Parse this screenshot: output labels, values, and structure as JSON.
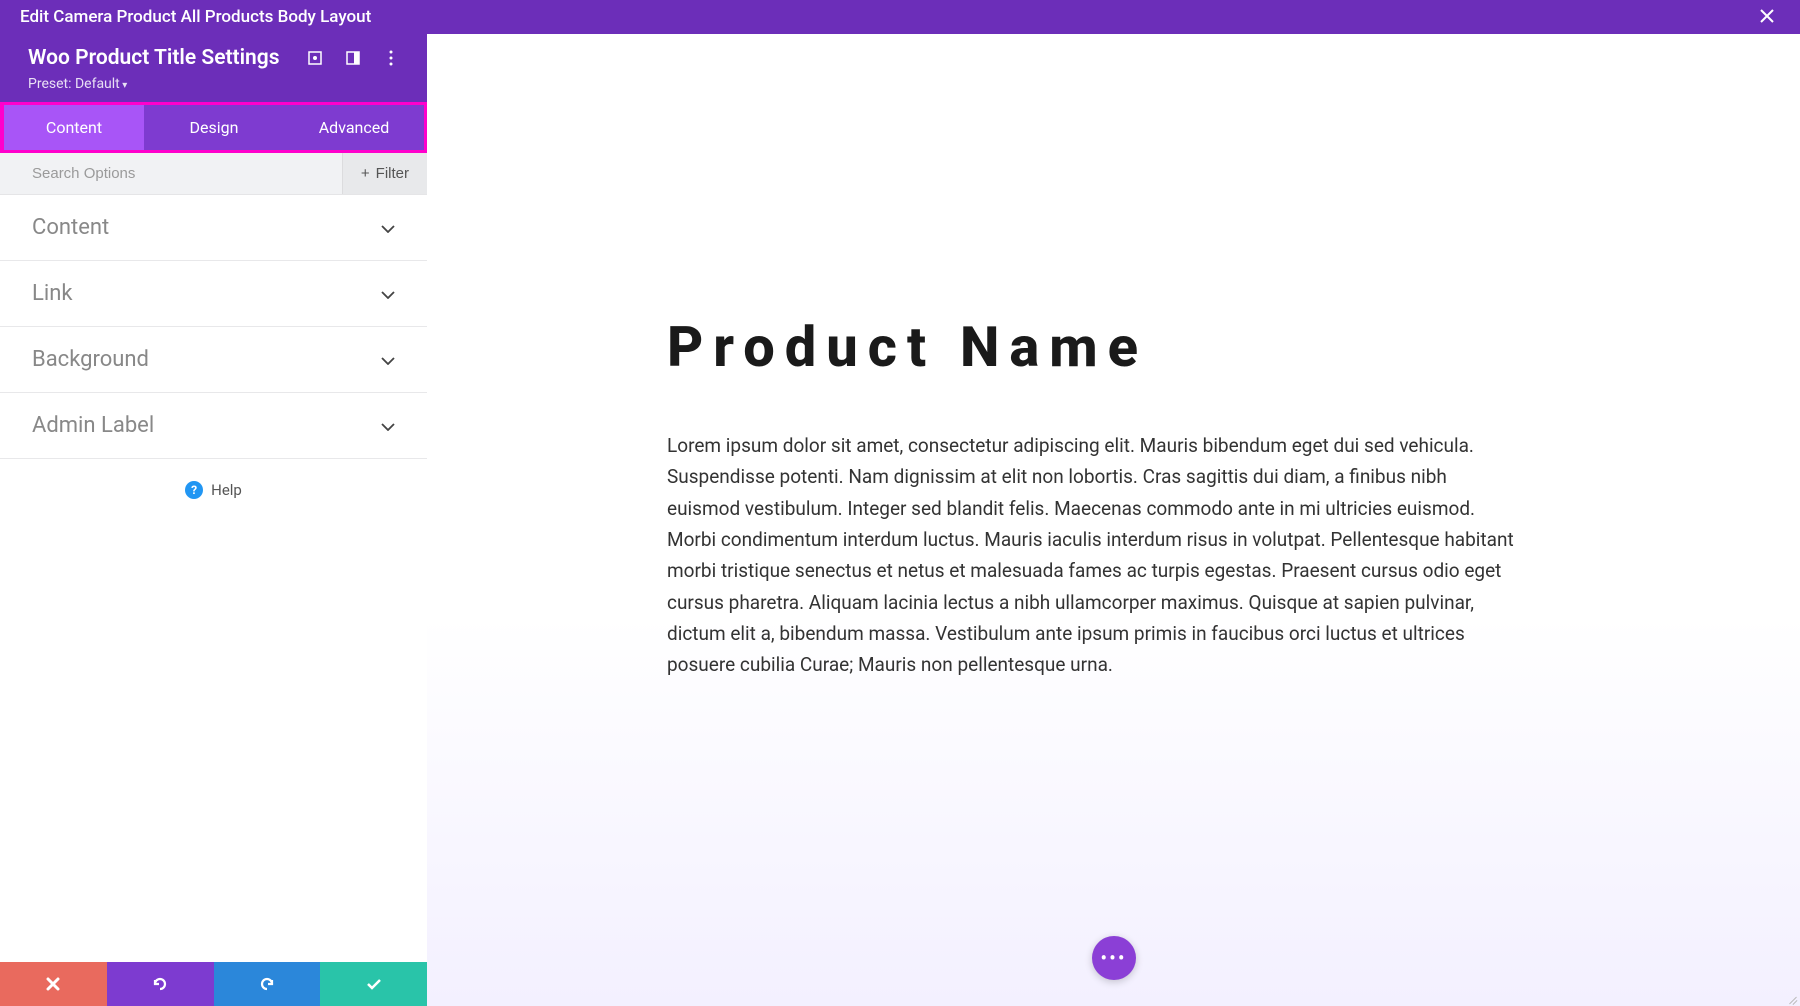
{
  "topBar": {
    "title": "Edit Camera Product All Products Body Layout"
  },
  "sidebar": {
    "title": "Woo Product Title Settings",
    "preset": "Preset: Default"
  },
  "tabs": {
    "content": "Content",
    "design": "Design",
    "advanced": "Advanced"
  },
  "search": {
    "placeholder": "Search Options",
    "filterLabel": "Filter"
  },
  "accordion": {
    "content": "Content",
    "link": "Link",
    "background": "Background",
    "adminLabel": "Admin Label"
  },
  "help": "Help",
  "preview": {
    "title": "Product Name",
    "description": "Lorem ipsum dolor sit amet, consectetur adipiscing elit. Mauris bibendum eget dui sed vehicula. Suspendisse potenti. Nam dignissim at elit non lobortis. Cras sagittis dui diam, a finibus nibh euismod vestibulum. Integer sed blandit felis. Maecenas commodo ante in mi ultricies euismod. Morbi condimentum interdum luctus. Mauris iaculis interdum risus in volutpat. Pellentesque habitant morbi tristique senectus et netus et malesuada fames ac turpis egestas. Praesent cursus odio eget cursus pharetra. Aliquam lacinia lectus a nibh ullamcorper maximus. Quisque at sapien pulvinar, dictum elit a, bibendum massa. Vestibulum ante ipsum primis in faucibus orci luctus et ultrices posuere cubilia Curae; Mauris non pellentesque urna."
  }
}
